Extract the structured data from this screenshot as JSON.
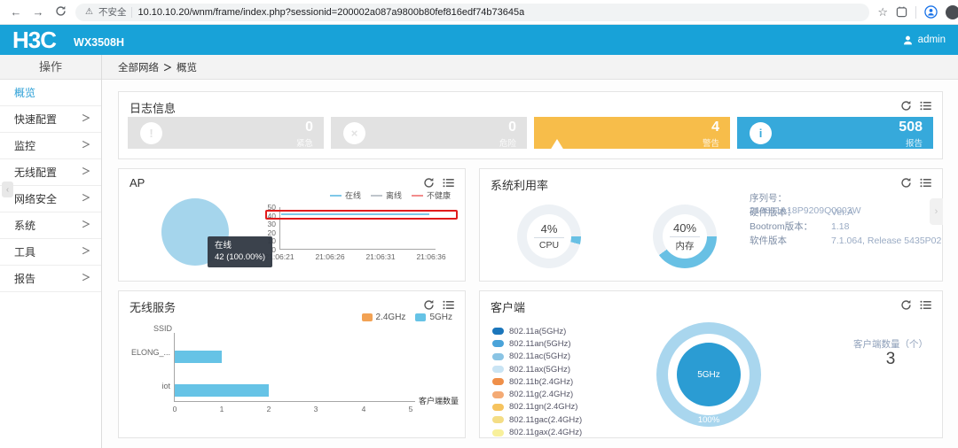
{
  "icons": {
    "back": "←",
    "forward": "→",
    "star": "☆",
    "warning": "⚠",
    "breadcrumb_sep": "＞",
    "sidebar_arrow": "＞",
    "collapse": "‹",
    "edge_next": "›"
  },
  "browser": {
    "security_label": "不安全",
    "url": "10.10.10.20/wnm/frame/index.php?sessionid=200002a087a9800b80fef816edf74b73645a"
  },
  "header": {
    "logo": "H3C",
    "model": "WX3508H",
    "user": "admin",
    "brand_color": "#18a2d8"
  },
  "sidebar": {
    "title": "操作",
    "items": [
      {
        "label": "概览",
        "active": true,
        "expandable": false
      },
      {
        "label": "快速配置",
        "active": false,
        "expandable": true
      },
      {
        "label": "监控",
        "active": false,
        "expandable": true
      },
      {
        "label": "无线配置",
        "active": false,
        "expandable": true
      },
      {
        "label": "网络安全",
        "active": false,
        "expandable": true
      },
      {
        "label": "系统",
        "active": false,
        "expandable": true
      },
      {
        "label": "工具",
        "active": false,
        "expandable": true
      },
      {
        "label": "报告",
        "active": false,
        "expandable": true
      }
    ]
  },
  "breadcrumb": {
    "root": "全部网络",
    "current": "概览"
  },
  "log_panel": {
    "title": "日志信息",
    "cards": [
      {
        "value": "0",
        "label": "紧急",
        "bg": "#e2e2e2",
        "glyph": "!"
      },
      {
        "value": "0",
        "label": "危险",
        "bg": "#e2e2e2",
        "glyph": "×"
      },
      {
        "value": "4",
        "label": "警告",
        "bg": "#f7bd4a",
        "glyph": "!"
      },
      {
        "value": "508",
        "label": "报告",
        "bg": "#36a9db",
        "glyph": "i"
      }
    ]
  },
  "ap_panel": {
    "title": "AP",
    "tooltip": {
      "line1": "在线",
      "line2": "42 (100.00%)"
    }
  },
  "system_panel": {
    "title": "系统利用率",
    "gauge_accent": "#68c0e4",
    "gauge_track": "#edf1f5",
    "gauges": [
      {
        "value": "4%",
        "label": "CPU",
        "percent": 4
      },
      {
        "value": "40%",
        "label": "内存",
        "percent": 40
      }
    ],
    "info": [
      {
        "label": "序列号：",
        "value": "219801A18P9209Q0003W"
      },
      {
        "label": "硬件版本：",
        "value": "Ver.A"
      },
      {
        "label": "Bootrom版本：",
        "value": "1.18"
      },
      {
        "label": "软件版本",
        "value": "7.1.064, Release 5435P02"
      }
    ]
  },
  "wireless_panel": {
    "title": "无线服务"
  },
  "clients_panel": {
    "title": "客户端",
    "ring_color": "#a9d6ee",
    "legend": [
      {
        "label": "802.11a(5GHz)",
        "color": "#1b76bb"
      },
      {
        "label": "802.11an(5GHz)",
        "color": "#4aa3d9"
      },
      {
        "label": "802.11ac(5GHz)",
        "color": "#8ac4e4"
      },
      {
        "label": "802.11ax(5GHz)",
        "color": "#c9e4f4"
      },
      {
        "label": "802.11b(2.4GHz)",
        "color": "#ef8f49"
      },
      {
        "label": "802.11g(2.4GHz)",
        "color": "#f4aa74"
      },
      {
        "label": "802.11gn(2.4GHz)",
        "color": "#f6c35e"
      },
      {
        "label": "802.11gac(2.4GHz)",
        "color": "#f4dd85"
      },
      {
        "label": "802.11gax(2.4GHz)",
        "color": "#f8f09b"
      }
    ],
    "count_label": "客户端数量（个）",
    "count_value": "3"
  },
  "chart_data": [
    {
      "id": "ap-status",
      "type": "pie",
      "title": "AP",
      "slices": [
        {
          "label": "在线",
          "value": 42,
          "percent": "100.00%",
          "color": "#a5d5ec"
        }
      ],
      "tooltip": "在线 42 (100.00%)"
    },
    {
      "id": "ap-trend",
      "type": "line",
      "x": [
        "21:06:21",
        "21:06:26",
        "21:06:31",
        "21:06:36"
      ],
      "ylim": [
        0,
        50
      ],
      "yticks": [
        "0",
        "10",
        "20",
        "30",
        "40",
        "50"
      ],
      "series": [
        {
          "name": "在线",
          "color": "#7fc8e8",
          "values": [
            42,
            42,
            42,
            42
          ]
        },
        {
          "name": "离线",
          "color": "#bfc5cb",
          "values": [
            0,
            0,
            0,
            0
          ]
        },
        {
          "name": "不健康",
          "color": "#f28c8c",
          "values": [
            0,
            0,
            0,
            0
          ]
        }
      ],
      "legend_position": "top",
      "annotation": {
        "type": "red-highlight-box",
        "around": "online line near value 40-45"
      }
    },
    {
      "id": "wireless-ssid",
      "type": "bar",
      "orientation": "horizontal",
      "categories": [
        "ELONG_...",
        "iot"
      ],
      "series": [
        {
          "name": "2.4GHz",
          "color": "#f2a254",
          "values": [
            0,
            0
          ]
        },
        {
          "name": "5GHz",
          "color": "#66c3e6",
          "values": [
            1,
            2
          ]
        }
      ],
      "xlabel": "客户端数量",
      "ylabel": "SSID",
      "xlim": [
        0,
        5
      ],
      "xticks": [
        "0",
        "1",
        "2",
        "3",
        "4",
        "5"
      ],
      "legend_position": "top-right"
    },
    {
      "id": "clients-band",
      "type": "pie",
      "donut": true,
      "slices": [
        {
          "label": "5GHz",
          "percent": "100%",
          "color": "#2b9cd3"
        }
      ],
      "total_label": "客户端数量（个）",
      "total": 3
    }
  ]
}
